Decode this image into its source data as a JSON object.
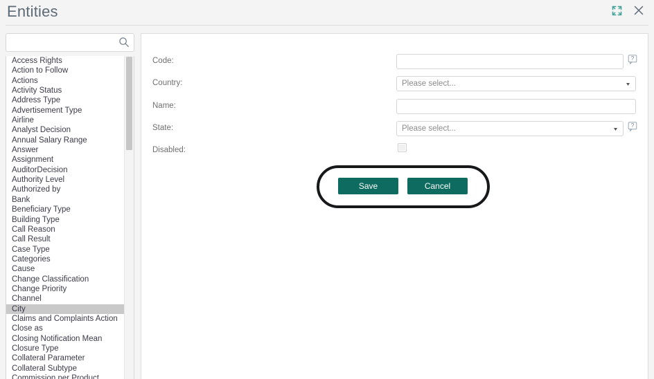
{
  "window": {
    "title": "Entities",
    "expand_icon": "expand-icon",
    "close_icon": "close-icon"
  },
  "colors": {
    "accent": "#0d6b5f",
    "title_text": "#5d6a76",
    "highlight_ring": "#17181a",
    "list_selected_bg": "#c9c9c9",
    "panel_bg": "#ffffff",
    "app_bg": "#f4f4f4"
  },
  "sidebar": {
    "search": {
      "value": "",
      "placeholder": "",
      "icon": "search-icon"
    },
    "selected_item": "City",
    "items": [
      "Access Rights",
      "Action to Follow",
      "Actions",
      "Activity Status",
      "Address Type",
      "Advertisement Type",
      "Airline",
      "Analyst Decision",
      "Annual Salary Range",
      "Answer",
      "Assignment",
      "AuditorDecision",
      "Authority Level",
      "Authorized by",
      "Bank",
      "Beneficiary Type",
      "Building Type",
      "Call Reason",
      "Call Result",
      "Case Type",
      "Categories",
      "Cause",
      "Change Classification",
      "Change Priority",
      "Channel",
      "City",
      "Claims and Complaints Action",
      "Close as",
      "Closing Notification Mean",
      "Closure Type",
      "Collateral Parameter",
      "Collateral Subtype",
      "Commission per Product"
    ]
  },
  "form": {
    "fields": [
      {
        "label": "Code:",
        "type": "text",
        "value": "",
        "placeholder": "",
        "has_help": true
      },
      {
        "label": "Country:",
        "type": "select",
        "value": "Please select...",
        "has_help": false
      },
      {
        "label": "Name:",
        "type": "text",
        "value": "",
        "placeholder": "",
        "has_help": false
      },
      {
        "label": "State:",
        "type": "select",
        "value": "Please select...",
        "has_help": true
      },
      {
        "label": "Disabled:",
        "type": "checkbox",
        "checked": false,
        "has_help": false
      }
    ],
    "buttons": {
      "save": "Save",
      "cancel": "Cancel"
    }
  }
}
